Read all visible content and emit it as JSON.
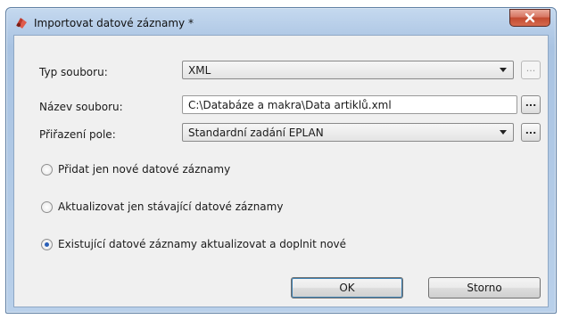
{
  "window": {
    "title": "Importovat datové záznamy *",
    "close_label": "x"
  },
  "form": {
    "file_type": {
      "label": "Typ souboru:",
      "value": "XML",
      "browse_label": "..."
    },
    "file_name": {
      "label": "Název souboru:",
      "value": "C:\\Databáze a makra\\Data artiklů.xml",
      "browse_label": "..."
    },
    "field_assignment": {
      "label": "Přiřazení pole:",
      "value": "Standardní zadání EPLAN",
      "browse_label": "..."
    }
  },
  "options": [
    {
      "label": "Přidat jen nové datové záznamy",
      "checked": false
    },
    {
      "label": "Aktualizovat jen stávající datové záznamy",
      "checked": false
    },
    {
      "label": "Existující datové záznamy aktualizovat a doplnit nové",
      "checked": true
    }
  ],
  "buttons": {
    "ok_label": "OK",
    "cancel_label": "Storno"
  },
  "colors": {
    "accent": "#2a5fb8",
    "close_button": "#c24a30"
  }
}
